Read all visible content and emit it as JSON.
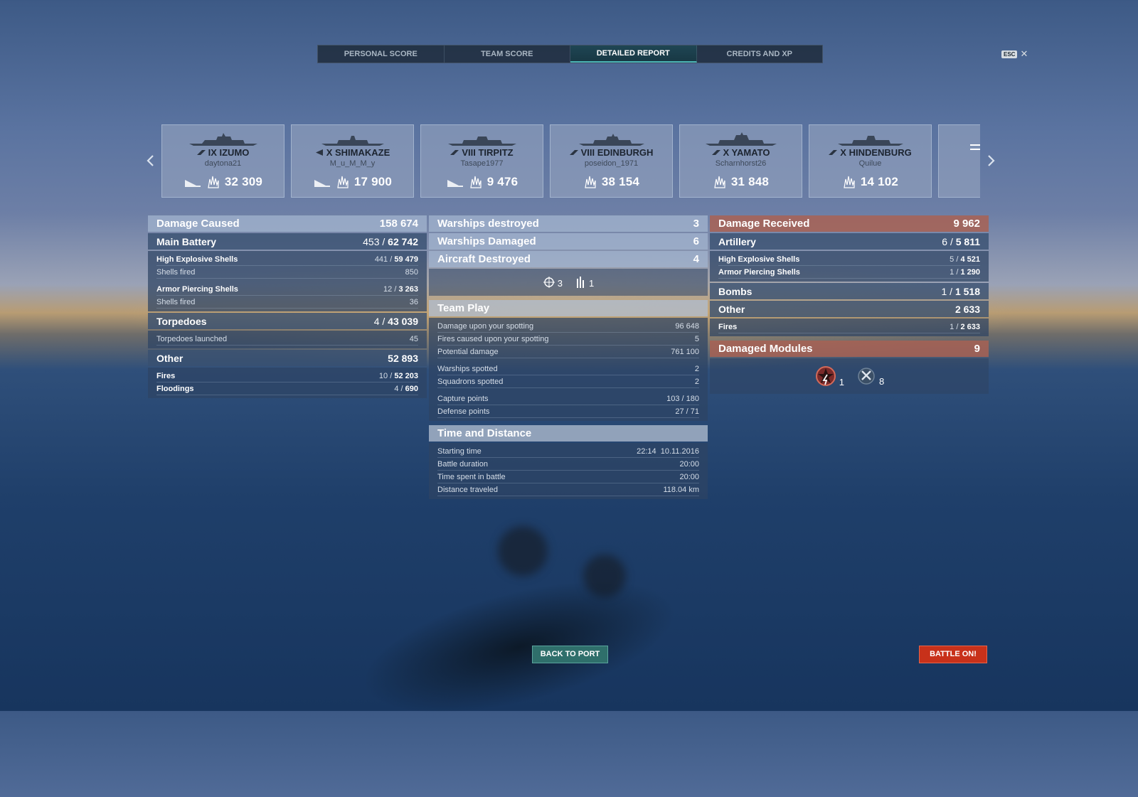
{
  "tabs": [
    {
      "label": "PERSONAL SCORE"
    },
    {
      "label": "TEAM SCORE"
    },
    {
      "label": "DETAILED REPORT"
    },
    {
      "label": "CREDITS AND XP"
    }
  ],
  "esc": {
    "key": "ESC",
    "close": "✕"
  },
  "ships": [
    {
      "name": "IX IZUMO",
      "player": "daytona21",
      "damage": "32 309"
    },
    {
      "name": "X SHIMAKAZE",
      "player": "M_u_M_M_y",
      "damage": "17 900"
    },
    {
      "name": "VIII TIRPITZ",
      "player": "Tasape1977",
      "damage": "9 476"
    },
    {
      "name": "VIII EDINBURGH",
      "player": "poseidon_1971",
      "damage": "38 154"
    },
    {
      "name": "X YAMATO",
      "player": "Scharnhorst26",
      "damage": "31 848"
    },
    {
      "name": "X HINDENBURG",
      "player": "Quilue",
      "damage": "14 102"
    }
  ],
  "left": {
    "damage_caused": {
      "label": "Damage Caused",
      "value": "158 674"
    },
    "main_battery": {
      "label": "Main Battery",
      "hits": "453",
      "value": "62 742"
    },
    "he": {
      "label": "High Explosive Shells",
      "hits": "441",
      "value": "59 479",
      "fired_label": "Shells fired",
      "fired": "850"
    },
    "ap": {
      "label": "Armor Piercing Shells",
      "hits": "12",
      "value": "3 263",
      "fired_label": "Shells fired",
      "fired": "36"
    },
    "torpedoes": {
      "label": "Torpedoes",
      "hits": "4",
      "value": "43 039",
      "launched_label": "Torpedoes launched",
      "launched": "45"
    },
    "other": {
      "label": "Other",
      "value": "52 893"
    },
    "fires": {
      "label": "Fires",
      "hits": "10",
      "value": "52 203"
    },
    "floodings": {
      "label": "Floodings",
      "hits": "4",
      "value": "690"
    }
  },
  "middle": {
    "destroyed": {
      "label": "Warships destroyed",
      "value": "3"
    },
    "damaged": {
      "label": "Warships Damaged",
      "value": "6"
    },
    "aircraft": {
      "label": "Aircraft Destroyed",
      "value": "4"
    },
    "aircraft_icons": {
      "fighter": "3",
      "aa": "1"
    },
    "team_play": {
      "title": "Team Play",
      "spot_damage": {
        "label": "Damage upon your spotting",
        "value": "96 648"
      },
      "spot_fires": {
        "label": "Fires caused upon your spotting",
        "value": "5"
      },
      "potential": {
        "label": "Potential damage",
        "value": "761 100"
      },
      "warships_spotted": {
        "label": "Warships spotted",
        "value": "2"
      },
      "squadrons_spotted": {
        "label": "Squadrons spotted",
        "value": "2"
      },
      "capture": {
        "label": "Capture points",
        "value": "103 / 180"
      },
      "defense": {
        "label": "Defense points",
        "value": "27 / 71"
      }
    },
    "time": {
      "title": "Time and Distance",
      "start": {
        "label": "Starting time",
        "value": "22:14  10.11.2016"
      },
      "duration": {
        "label": "Battle duration",
        "value": "20:00"
      },
      "spent": {
        "label": "Time spent in battle",
        "value": "20:00"
      },
      "distance": {
        "label": "Distance traveled",
        "value": "118.04 km"
      }
    }
  },
  "right": {
    "received": {
      "label": "Damage Received",
      "value": "9 962"
    },
    "artillery": {
      "label": "Artillery",
      "hits": "6",
      "value": "5 811"
    },
    "he": {
      "label": "High Explosive Shells",
      "hits": "5",
      "value": "4 521"
    },
    "ap": {
      "label": "Armor Piercing Shells",
      "hits": "1",
      "value": "1 290"
    },
    "bombs": {
      "label": "Bombs",
      "hits": "1",
      "value": "1 518"
    },
    "other": {
      "label": "Other",
      "value": "2 633"
    },
    "fires": {
      "label": "Fires",
      "hits": "1",
      "value": "2 633"
    },
    "modules": {
      "label": "Damaged Modules",
      "value": "9",
      "incap": "1",
      "destroyed": "8"
    }
  },
  "buttons": {
    "back": "BACK TO PORT",
    "battle": "BATTLE ON!"
  },
  "colors": {
    "accent": "#4ab4b4",
    "battle": "#c8311a",
    "received_header": "#a86254"
  }
}
